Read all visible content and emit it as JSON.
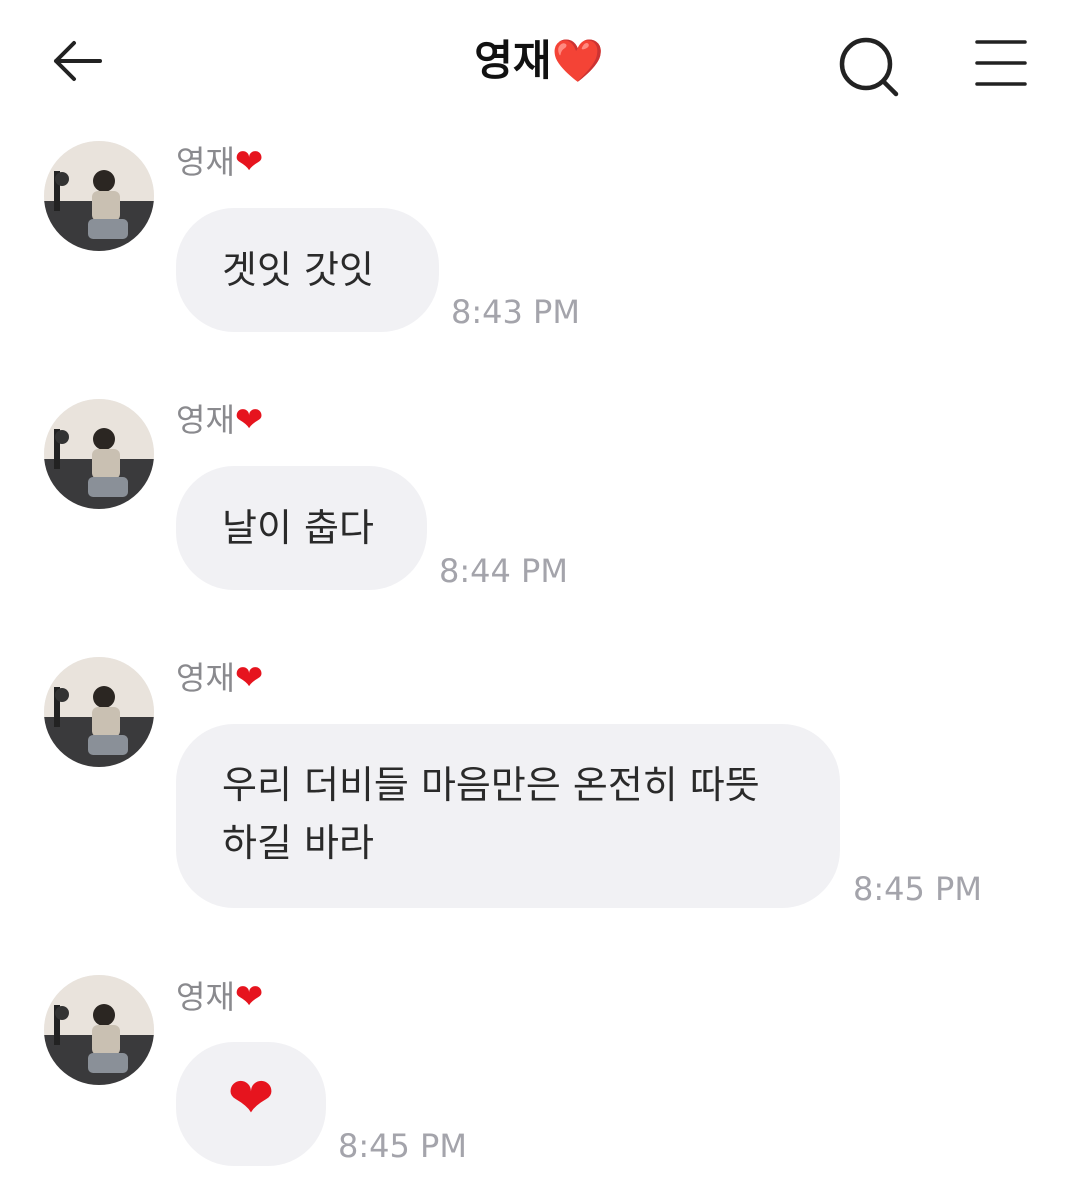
{
  "header": {
    "title": "영재❤️",
    "back_icon": "arrow-left-icon",
    "search_icon": "search-icon",
    "menu_icon": "hamburger-menu-icon"
  },
  "messages": [
    {
      "sender": "영재",
      "sender_heart": "❤",
      "text": "겟잇 갓잇",
      "time": "8:43 PM"
    },
    {
      "sender": "영재",
      "sender_heart": "❤",
      "text": "날이 춥다",
      "time": "8:44 PM"
    },
    {
      "sender": "영재",
      "sender_heart": "❤",
      "text": "우리 더비들 마음만은 온전히 따뜻\n하길 바라",
      "time": "8:45 PM"
    },
    {
      "sender": "영재",
      "sender_heart": "❤",
      "text": "❤",
      "time": "8:45 PM"
    }
  ],
  "colors": {
    "bubble": "#f1f1f4",
    "heart": "#e6141e",
    "meta_text": "#a4a4ab"
  }
}
